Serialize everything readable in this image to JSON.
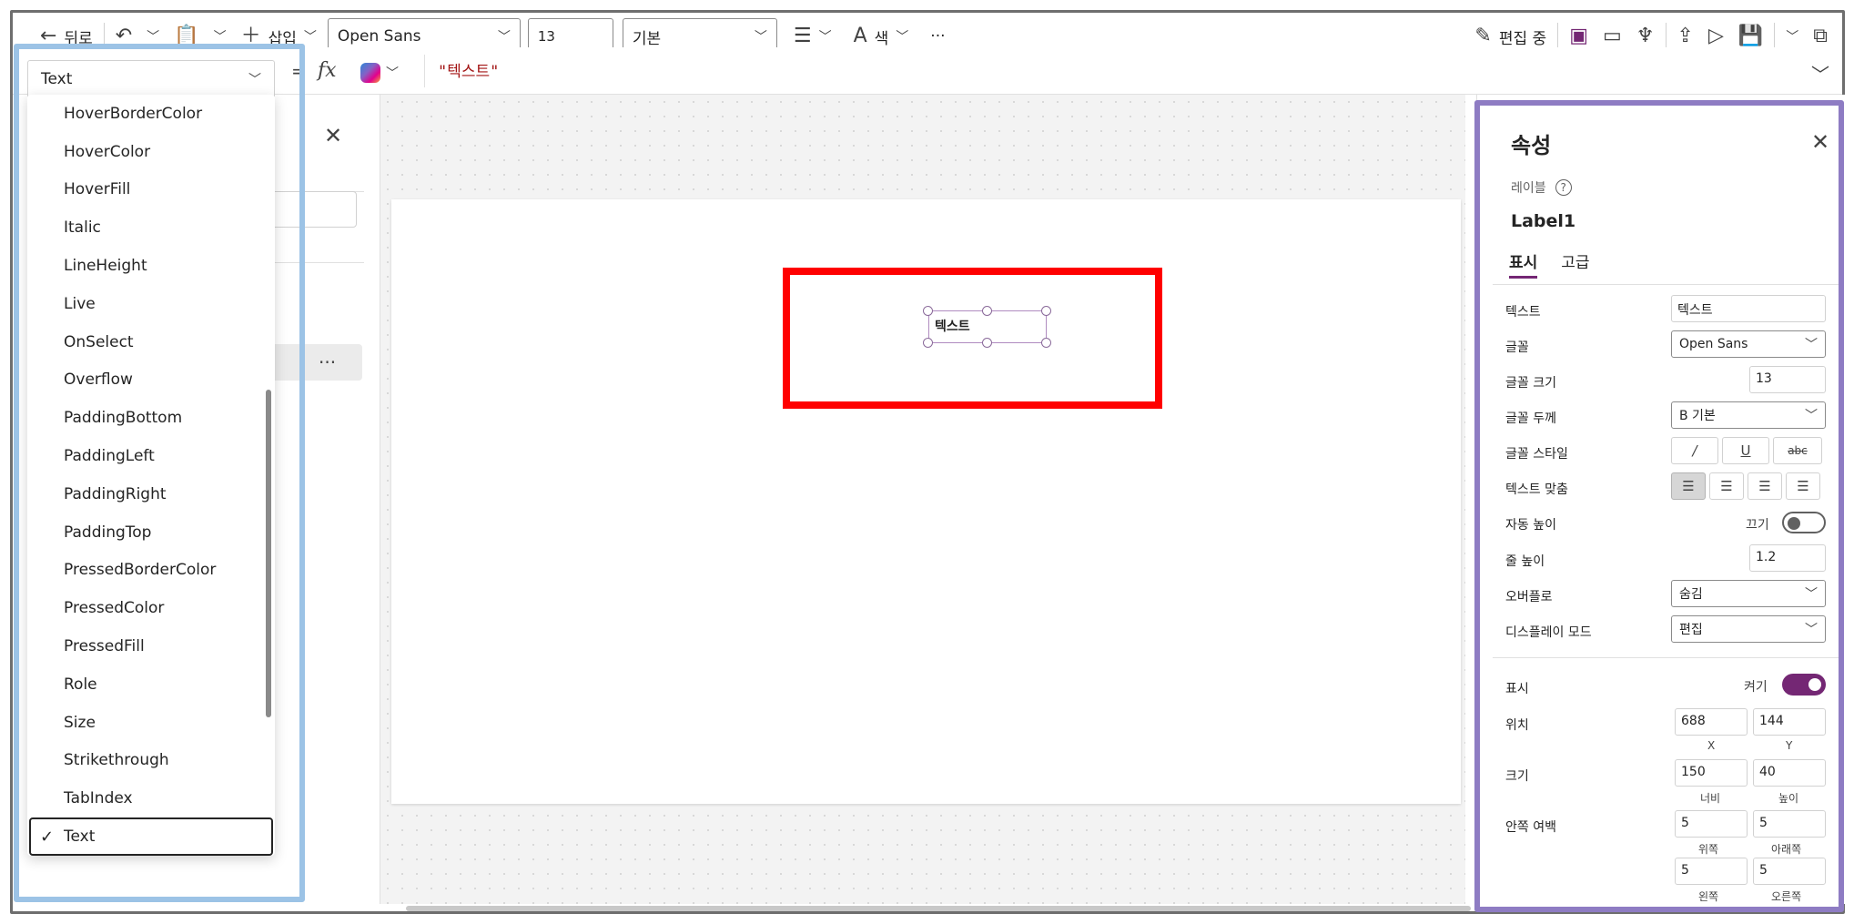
{
  "toolbar": {
    "back_label": "뒤로",
    "insert_label": "삽입",
    "font": "Open Sans",
    "font_size": "13",
    "font_weight": "기본",
    "color_label": "색",
    "more_label": "···",
    "editing_label": "편집 중"
  },
  "formula_bar": {
    "property": "Text",
    "equals": "=",
    "fx": "fx",
    "value": "\"텍스트\""
  },
  "property_list": {
    "items": [
      "HoverBorderColor",
      "HoverColor",
      "HoverFill",
      "Italic",
      "LineHeight",
      "Live",
      "OnSelect",
      "Overflow",
      "PaddingBottom",
      "PaddingLeft",
      "PaddingRight",
      "PaddingTop",
      "PressedBorderColor",
      "PressedColor",
      "PressedFill",
      "Role",
      "Size",
      "Strikethrough",
      "TabIndex"
    ],
    "selected": "Text",
    "check": "✓"
  },
  "left_panel": {
    "more": "···"
  },
  "canvas": {
    "label_text": "텍스트"
  },
  "properties_pane": {
    "title": "속성",
    "control_type": "레이블",
    "control_name": "Label1",
    "tabs": [
      "표시",
      "고급"
    ],
    "text_label": "텍스트",
    "text_value": "텍스트",
    "font_label": "글꼴",
    "font_value": "Open Sans",
    "font_size_label": "글꼴 크기",
    "font_size_value": "13",
    "font_weight_label": "글꼴 두께",
    "font_weight_value": "B  기본",
    "font_style_label": "글꼴 스타일",
    "font_style_buttons": [
      "/",
      "U",
      "abc"
    ],
    "text_align_label": "텍스트 맞춤",
    "auto_height_label": "자동 높이",
    "auto_height_state": "끄기",
    "line_height_label": "줄 높이",
    "line_height_value": "1.2",
    "overflow_label": "오버플로",
    "overflow_value": "숨김",
    "display_mode_label": "디스플레이 모드",
    "display_mode_value": "편집",
    "visible_label": "표시",
    "visible_state": "켜기",
    "position_label": "위치",
    "x_value": "688",
    "y_value": "144",
    "x_caption": "X",
    "y_caption": "Y",
    "size_label": "크기",
    "width_value": "150",
    "height_value": "40",
    "width_caption": "너비",
    "height_caption": "높이",
    "padding_label": "안쪽 여백",
    "padding_top": "5",
    "padding_bottom": "5",
    "padding_left": "5",
    "padding_right": "5",
    "top_caption": "위쪽",
    "bottom_caption": "아래쪽",
    "left_caption": "왼쪽",
    "right_caption": "오른쪽"
  },
  "colors": {
    "accent": "#742774",
    "highlight_blue": "#9cc3e6",
    "highlight_red": "#ff0000",
    "highlight_purple": "#8e7cc3"
  }
}
